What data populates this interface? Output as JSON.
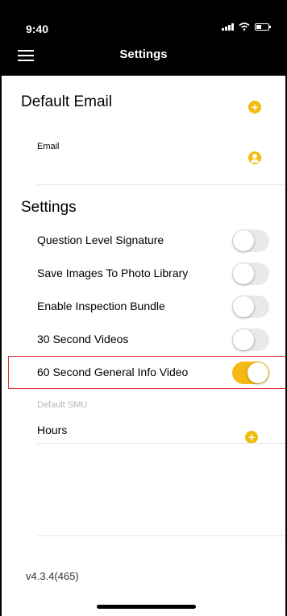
{
  "status_bar": {
    "time": "9:40"
  },
  "nav": {
    "title": "Settings"
  },
  "default_email": {
    "section_title": "Default Email",
    "field_label": "Email"
  },
  "settings": {
    "section_title": "Settings",
    "toggles": [
      {
        "label": "Question Level Signature",
        "on": false
      },
      {
        "label": "Save Images To Photo Library",
        "on": false
      },
      {
        "label": "Enable Inspection Bundle",
        "on": false
      },
      {
        "label": "30 Second Videos",
        "on": false
      },
      {
        "label": "60 Second General Info Video",
        "on": true
      }
    ],
    "default_smu": {
      "label": "Default SMU",
      "value": "Hours"
    }
  },
  "footer": {
    "version": "v4.3.4(465)"
  },
  "colors": {
    "accent": "#f6b813",
    "highlight_border": "#e0303a",
    "toggle_off": "#e9e9ea"
  },
  "icons": {
    "menu": "hamburger-menu-icon",
    "add": "plus-circle-icon",
    "person": "person-circle-icon"
  }
}
